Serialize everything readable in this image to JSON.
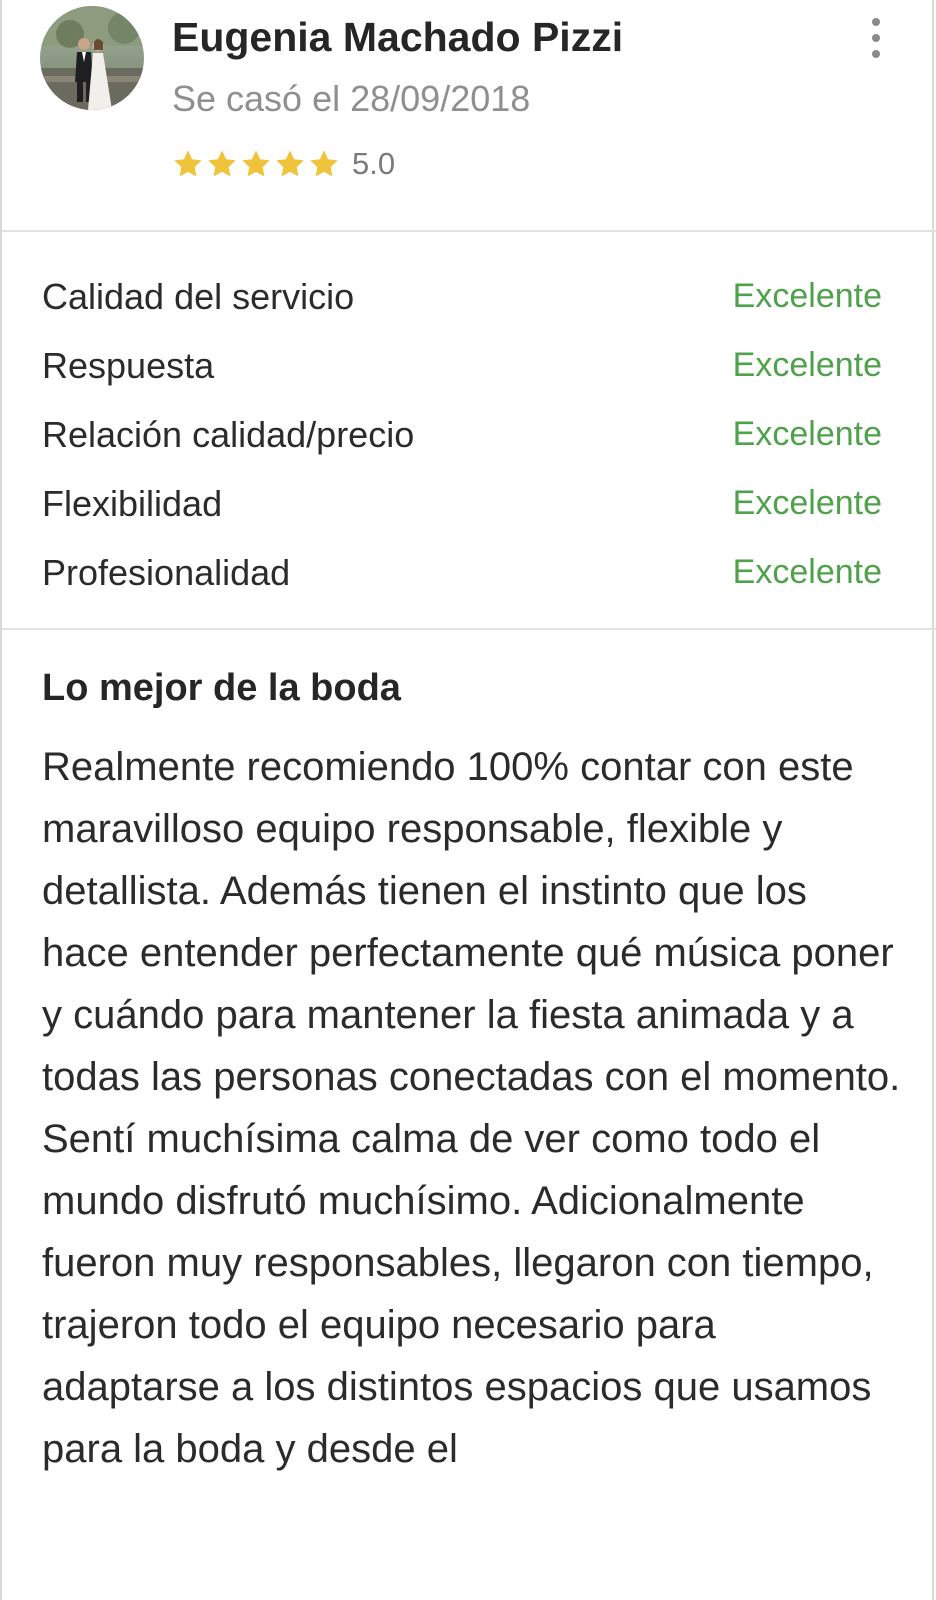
{
  "review": {
    "author": {
      "name": "Eugenia Machado Pizzi",
      "married_text": "Se casó el 28/09/2018",
      "avatar_icon": "avatar-photo"
    },
    "overall_rating": {
      "stars": 5,
      "max_stars": 5,
      "value_text": "5.0",
      "star_color": "#f0c43a"
    },
    "menu_icon": "more-vertical-icon",
    "categories": [
      {
        "label": "Calidad del servicio",
        "score": "Excelente"
      },
      {
        "label": "Respuesta",
        "score": "Excelente"
      },
      {
        "label": "Relación calidad/precio",
        "score": "Excelente"
      },
      {
        "label": "Flexibilidad",
        "score": "Excelente"
      },
      {
        "label": "Profesionalidad",
        "score": "Excelente"
      }
    ],
    "score_color": "#4fa24b",
    "best_of_wedding": {
      "title": "Lo mejor de la boda",
      "text": "Realmente recomiendo 100% contar con este maravilloso equipo responsable, flexible y detallista. Además tienen el instinto que los hace entender perfectamente qué música poner y cuándo para mantener la fiesta animada y a todas las personas conectadas con el momento. Sentí muchísima calma de ver como todo el mundo disfrutó muchísimo. Adicionalmente fueron muy responsables, llegaron con tiempo, trajeron todo el equipo necesario para adaptarse a los distintos espacios que usamos para la boda y desde el"
    }
  }
}
